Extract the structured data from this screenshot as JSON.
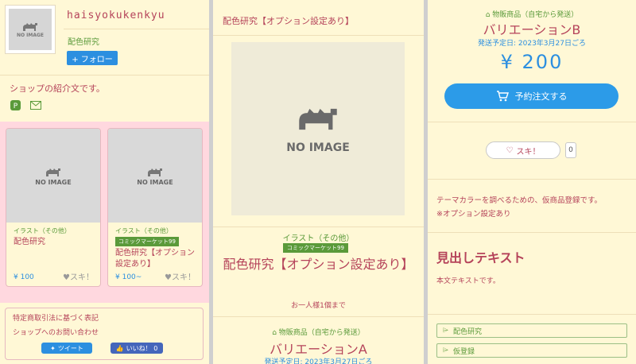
{
  "shop": {
    "name": "haisyokukenkyu",
    "subtitle": "配色研究",
    "follow_label": "+ フォロー",
    "intro": "ショップの紹介文です。",
    "avatar_text": "NO IMAGE"
  },
  "products": [
    {
      "image_text": "NO IMAGE",
      "category": "イラスト（その他）",
      "badge": "",
      "title": "配色研究",
      "price": "¥ 100",
      "like": "♥スキ！"
    },
    {
      "image_text": "NO IMAGE",
      "category": "イラスト（その他）",
      "badge": "コミックマーケット99",
      "title": "配色研究【オプション設定あり】",
      "price": "¥ 100~",
      "like": "♥スキ！"
    }
  ],
  "footer": {
    "law": "特定商取引法に基づく表記",
    "contact": "ショップへのお問い合わせ",
    "tweet": "ツイート",
    "fb_like": "いいね！ 0"
  },
  "detail": {
    "header_title": "配色研究【オプション設定あり】",
    "image_text": "NO IMAGE",
    "category": "イラスト（その他）",
    "badge": "コミックマーケット99",
    "name": "配色研究【オプション設定あり】",
    "limit": "お一人様1個まで",
    "variation_a": {
      "kind": "物販商品（自宅から発送）",
      "name": "バリエーションA",
      "date": "発送予定日: 2023年3月27日ごろ"
    }
  },
  "right": {
    "kind": "物販商品（自宅から発送）",
    "name": "バリエーションB",
    "date": "発送予定日: 2023年3月27日ごろ",
    "price": "¥ 200",
    "order_label": "予約注文する",
    "like_label": "スキ！",
    "like_count": "0",
    "desc1": "テーマカラーを調べるための、仮商品登録です。",
    "desc2": "※オプション設定あり",
    "heading": "見出しテキスト",
    "body": "本文テキストです。",
    "tags": [
      "配色研究",
      "仮登録"
    ]
  },
  "colors": {
    "accent_blue": "#2c8fe0",
    "text_red": "#b5435a",
    "green": "#5a9a3a",
    "bg": "#fff8d6"
  }
}
